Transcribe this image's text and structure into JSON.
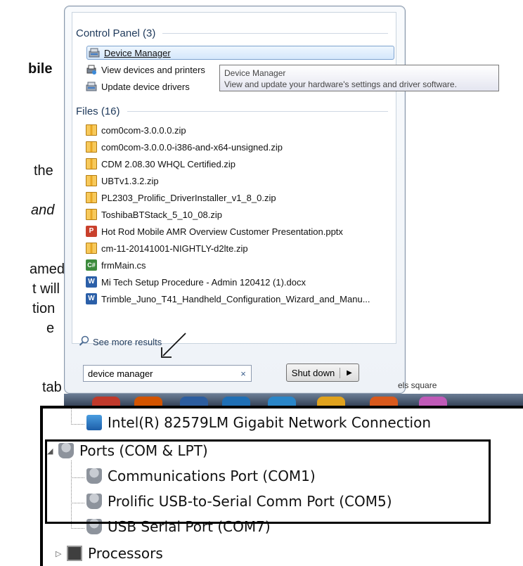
{
  "background_doc": {
    "fragments": [
      "bile",
      "the",
      "and",
      "amed",
      "t will",
      "tion",
      "e",
      "tab"
    ]
  },
  "start_menu": {
    "control_panel_header": "Control Panel (3)",
    "control_panel_items": [
      {
        "label": "Device Manager"
      },
      {
        "label": "View devices and printers"
      },
      {
        "label": "Update device drivers"
      }
    ],
    "files_header": "Files (16)",
    "files": [
      {
        "label": "com0com-3.0.0.0.zip",
        "icon": "zip-icon"
      },
      {
        "label": "com0com-3.0.0.0-i386-and-x64-unsigned.zip",
        "icon": "zip-icon"
      },
      {
        "label": "CDM 2.08.30 WHQL Certified.zip",
        "icon": "zip-icon"
      },
      {
        "label": "UBTv1.3.2.zip",
        "icon": "zip-icon"
      },
      {
        "label": "PL2303_Prolific_DriverInstaller_v1_8_0.zip",
        "icon": "zip-icon"
      },
      {
        "label": "ToshibaBTStack_5_10_08.zip",
        "icon": "zip-icon"
      },
      {
        "label": "Hot Rod Mobile AMR Overview Customer Presentation.pptx",
        "icon": "ppt-icon"
      },
      {
        "label": "cm-11-20141001-NIGHTLY-d2lte.zip",
        "icon": "zip-icon"
      },
      {
        "label": "frmMain.cs",
        "icon": "cs-icon"
      },
      {
        "label": "Mi Tech Setup Procedure - Admin 120412 (1).docx",
        "icon": "doc-icon"
      },
      {
        "label": "Trimble_Juno_T41_Handheld_Configuration_Wizard_and_Manu...",
        "icon": "doc-icon"
      }
    ],
    "see_more": "See more results",
    "search": {
      "value": "device manager",
      "clear": "×"
    },
    "shutdown_label": "Shut down"
  },
  "tooltip": {
    "title": "Device Manager",
    "description": "View and update your hardware's settings and driver software."
  },
  "doc_line_fragment": "els square",
  "device_manager": {
    "network_item": "Intel(R) 82579LM Gigabit Network Connection",
    "ports_category": "Ports (COM & LPT)",
    "ports": [
      "Communications Port (COM1)",
      "Prolific USB-to-Serial Comm Port (COM5)",
      "USB Serial Port (COM7)"
    ],
    "processors": "Processors"
  }
}
